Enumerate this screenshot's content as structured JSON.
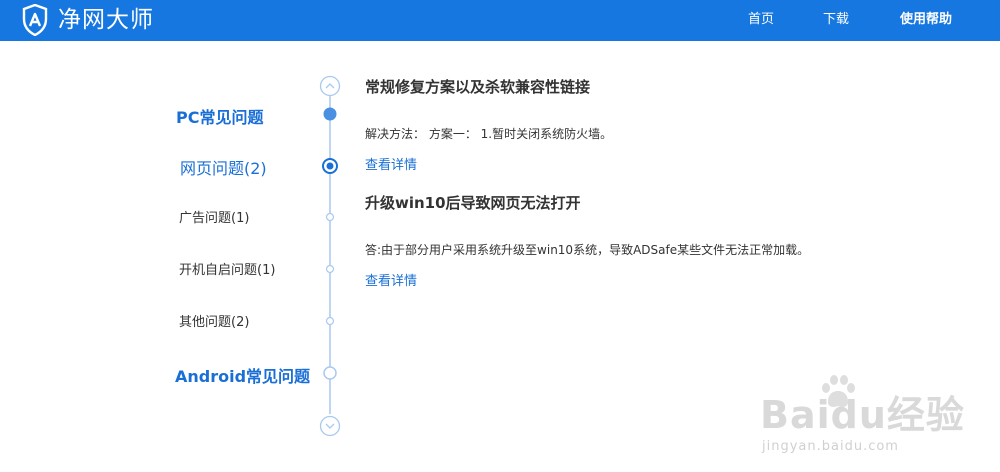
{
  "header": {
    "brand": "净网大师",
    "logo_icon": "shield-logo-icon",
    "nav": {
      "home": "首页",
      "download": "下载",
      "help": "使用帮助"
    }
  },
  "sidebar": {
    "pc_section": "PC常见问题",
    "web_problems": "网页问题(2)",
    "ad_problems": "广告问题(1)",
    "boot_problems": "开机自启问题(1)",
    "other_problems": "其他问题(2)",
    "android_section": "Android常见问题"
  },
  "questions": [
    {
      "title": "常规修复方案以及杀软兼容性链接",
      "desc": "解决方法： 方案一： 1.暂时关闭系统防火墙。",
      "link": "查看详情"
    },
    {
      "title": "升级win10后导致网页无法打开",
      "desc": "答:由于部分用户采用系统升级至win10系统，导致ADSafe某些文件无法正常加载。",
      "link": "查看详情"
    }
  ],
  "timeline": {
    "up_icon": "chevron-up-icon",
    "down_icon": "chevron-down-icon"
  },
  "watermark": {
    "brand": "Baidu经验",
    "url": "jingyan.baidu.com"
  },
  "colors": {
    "header_bg": "#1677e0",
    "accent": "#1a6fd6",
    "timeline": "#a9c9ef"
  }
}
